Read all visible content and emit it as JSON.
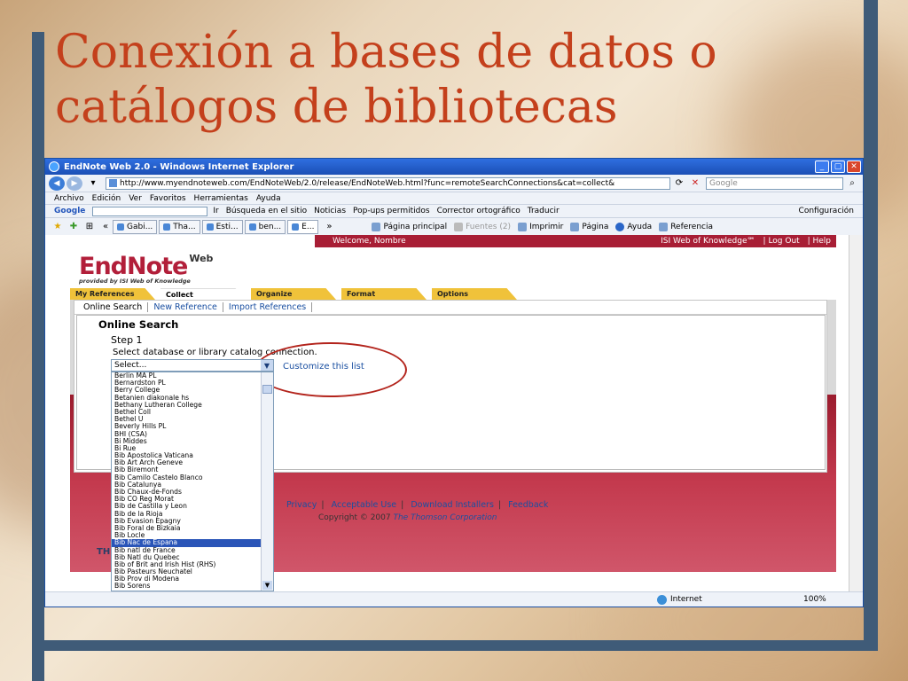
{
  "slide": {
    "title_line1": "Conexión a bases de datos o",
    "title_line2": "catálogos de bibliotecas"
  },
  "browser": {
    "window_title": "EndNote Web 2.0 - Windows Internet Explorer",
    "url": "http://www.myendnoteweb.com/EndNoteWeb/2.0/release/EndNoteWeb.html?func=remoteSearchConnections&cat=collect&",
    "search_placeholder": "Google",
    "menu": [
      "Archivo",
      "Edición",
      "Ver",
      "Favoritos",
      "Herramientas",
      "Ayuda"
    ],
    "google_bar": {
      "label": "Google",
      "items": [
        "Ir",
        "Búsqueda en el sitio",
        "Noticias",
        "Pop-ups permitidos",
        "Corrector ortográfico",
        "Traducir",
        "Configuración"
      ]
    },
    "tabs": [
      "Gabi...",
      "Tha...",
      "Esti...",
      "ben...",
      "E..."
    ],
    "commands": [
      "Página principal",
      "Fuentes (2)",
      "Imprimir",
      "Página",
      "Ayuda",
      "Referencia"
    ],
    "status": {
      "zone": "Internet",
      "zoom": "100%"
    }
  },
  "endnote": {
    "welcome": "Welcome, Nombre",
    "top_links": [
      "ISI Web of Knowledge℠",
      "| Log Out",
      "| Help"
    ],
    "logo": {
      "brand": "EndNote",
      "web": "Web",
      "sub": "provided by ISI Web of Knowledge"
    },
    "main_tabs": [
      "My References",
      "Collect",
      "Organize",
      "Format",
      "Options"
    ],
    "sub_tabs": [
      "Online Search",
      "New Reference",
      "Import References"
    ],
    "panel_title": "Online Search",
    "step": "Step 1",
    "instruction": "Select database or library catalog connection.",
    "select_value": "Select...",
    "customize_link": "Customize this list",
    "dropdown_items": [
      "Berlin MA PL",
      "Bernardston PL",
      "Berry College",
      "Betanien diakonale hs",
      "Bethany Lutheran College",
      "Bethel Coll",
      "Bethel U",
      "Beverly Hills PL",
      "BHI (CSA)",
      "Bi Middes",
      "Bi Rue",
      "Bib Apostolica Vaticana",
      "Bib Art Arch Geneve",
      "Bib Biremont",
      "Bib Camilo Castelo Blanco",
      "Bib Catalunya",
      "Bib Chaux-de-Fonds",
      "Bib CO Reg Morat",
      "Bib de Castilla y Leon",
      "Bib de la Rioja",
      "Bib Evasion Epagny",
      "Bib Foral de Bizkaia",
      "Bib Locle",
      "Bib Nac de Espana",
      "Bib natl de France",
      "Bib Natl du Quebec",
      "Bib of Brit and Irish Hist (RHS)",
      "Bib Pasteurs Neuchatel",
      "Bib Prov di Modena",
      "Bib Sorens"
    ],
    "selected_index": 23,
    "footer_links": [
      "Privacy",
      "Acceptable Use",
      "Download Installers",
      "Feedback"
    ],
    "copyright_prefix": "Copyright © 2007",
    "copyright_owner": "The Thomson Corporation",
    "thomson_logo": "TH"
  }
}
